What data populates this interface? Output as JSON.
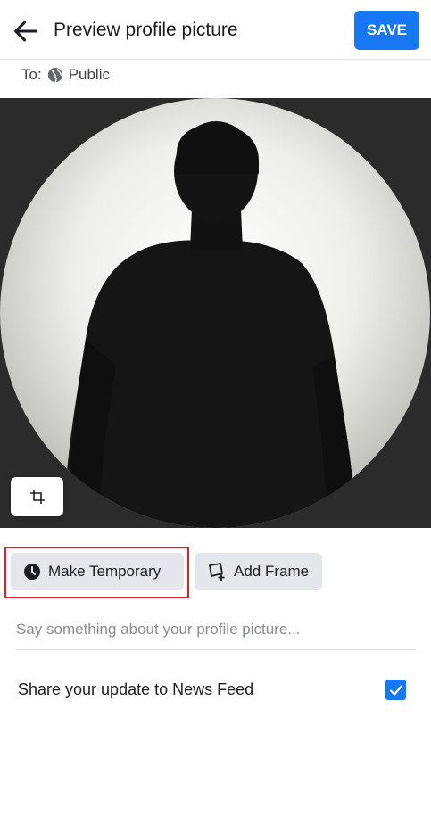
{
  "header": {
    "title": "Preview profile picture",
    "save_label": "SAVE"
  },
  "audience": {
    "prefix": "To:",
    "value": "Public"
  },
  "actions": {
    "make_temporary_label": "Make Temporary",
    "add_frame_label": "Add Frame"
  },
  "caption": {
    "placeholder": "Say something about your profile picture..."
  },
  "share": {
    "label": "Share your update to News Feed",
    "checked": true
  },
  "colors": {
    "accent": "#1877f2",
    "highlight": "#d9222a"
  },
  "icons": [
    "back-arrow-icon",
    "globe-icon",
    "crop-icon",
    "clock-icon",
    "frame-icon",
    "checkmark-icon"
  ]
}
